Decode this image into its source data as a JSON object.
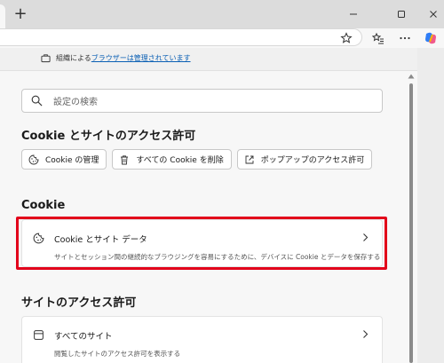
{
  "browser": {
    "new_tab": "+",
    "managed_prefix": "組織による",
    "managed_link": "ブラウザーは管理されています",
    "colors": {
      "tabstrip": "#dcdcdc",
      "link": "#0a5fb4",
      "highlight": "#e2001a"
    }
  },
  "settings": {
    "search_placeholder": "設定の検索",
    "section_access_title": "Cookie とサイトのアクセス許可",
    "buttons": {
      "manage_cookies": "Cookie の管理",
      "delete_cookies": "すべての Cookie を削除",
      "popups": "ポップアップのアクセス許可"
    },
    "section_cookie_title": "Cookie",
    "cookie_card": {
      "title": "Cookie とサイト データ",
      "description": "サイトとセッション間の継続的なブラウジングを容易にするために、デバイスに Cookie とデータを保存する"
    },
    "section_site_title": "サイトのアクセス許可",
    "all_sites_card": {
      "title": "すべてのサイト",
      "description": "閲覧したサイトのアクセス許可を表示する"
    }
  }
}
